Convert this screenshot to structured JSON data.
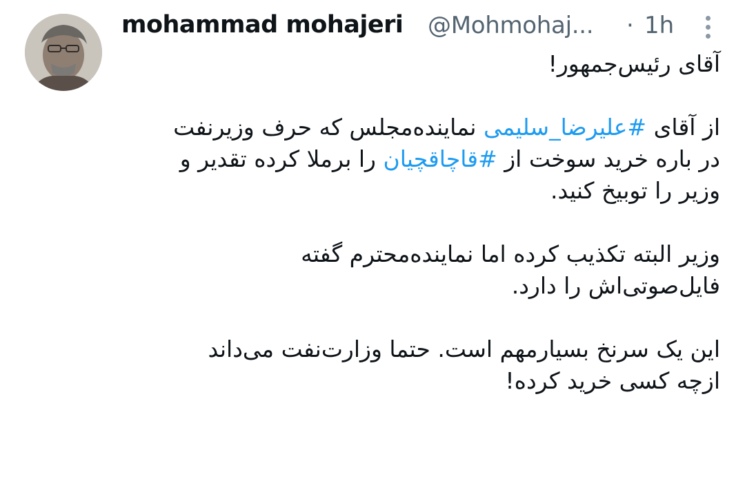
{
  "author": {
    "name": "mohammad mohajeri",
    "handle": "@Mohmohaj...",
    "separator": "·",
    "time": "1h"
  },
  "more_icon": "vertical-dots-icon",
  "avatar_icon": "profile-photo",
  "tweet": {
    "p1": "آقای رئیس‌جمهور!",
    "p2_a": "از آقای ",
    "p2_hashtag1": "#علیرضا_سلیمی",
    "p2_b": " نماینده‌مجلس که حرف وزیرنفت",
    "p2_c": "در باره خرید سوخت از ",
    "p2_hashtag2": "#قاچاقچیان",
    "p2_d": " را برملا کرده تقدیر و",
    "p2_e": "وزیر را توبیخ کنید.",
    "p3_a": "وزیر البته تکذیب کرده اما نماینده‌محترم گفته",
    "p3_b": "فایل‌صوتی‌اش را دارد.",
    "p4_a": "این یک سرنخ بسیارمهم است. حتما وزارت‌نفت می‌داند",
    "p4_b": "ازچه کسی خرید کرده!"
  },
  "colors": {
    "text": "#0f1419",
    "secondary": "#536471",
    "link": "#1d9bf0"
  }
}
